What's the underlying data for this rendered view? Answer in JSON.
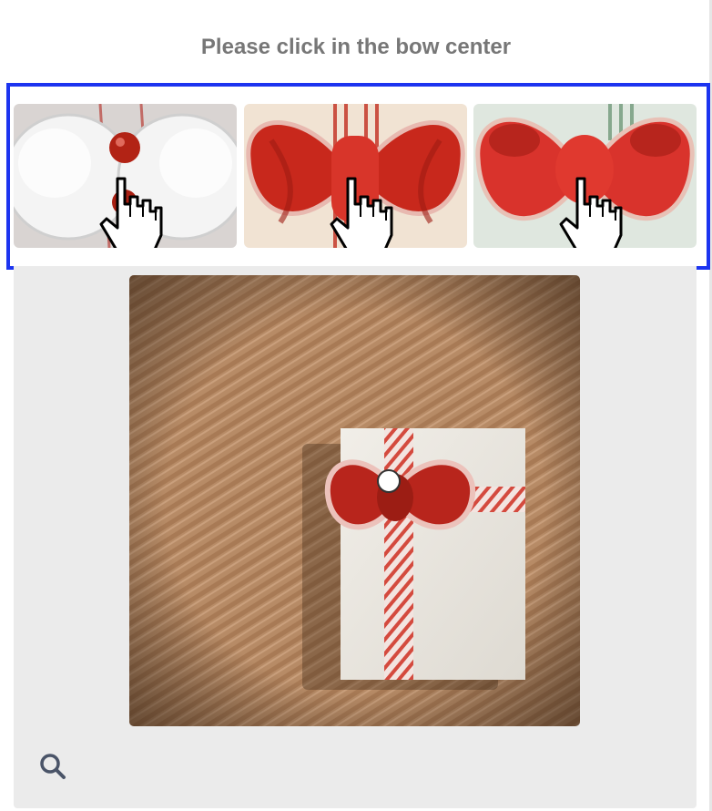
{
  "title": "Please click in the bow center",
  "examples": [
    {
      "label": "white bow example",
      "bow_color": "#efefef",
      "knot_color": "#b22315"
    },
    {
      "label": "red bow example",
      "bow_color": "#c8281c",
      "knot_color": "#d8352a"
    },
    {
      "label": "bright red bow example",
      "bow_color": "#d9332c",
      "knot_color": "#e0392f"
    }
  ],
  "puzzle": {
    "background_color": "#b78b66",
    "gift_color": "#ece9e2",
    "bow_color": "#b8251c",
    "ribbon_color": "#e9b3ad"
  },
  "colors": {
    "accent": "#1c34f0",
    "title": "#777777",
    "panel": "#ebebeb",
    "icon": "#4a5468"
  },
  "icons": {
    "zoom": "search-icon",
    "example_cursor": "pointing-hand-icon"
  }
}
